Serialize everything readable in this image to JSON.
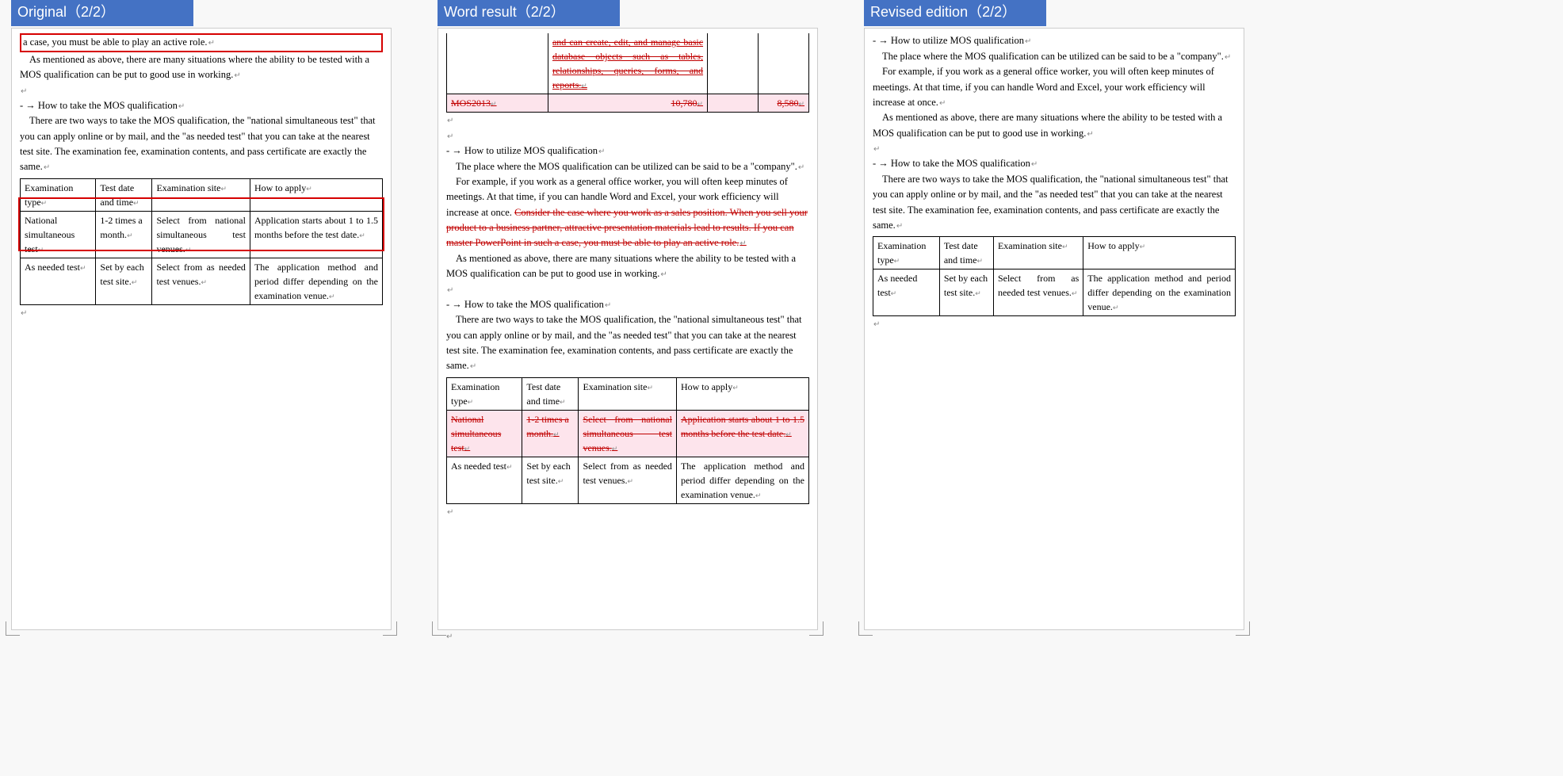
{
  "tabs": {
    "original": "Original（2/2）",
    "word_result": "Word result（2/2）",
    "revised": "Revised edition（2/2）"
  },
  "common": {
    "utilize_heading": "- → How to utilize MOS qualification",
    "take_heading": "- → How to take the MOS qualification",
    "utilize_p1": "The place where the MOS qualification can be utilized can be said to be a \"company\".",
    "utilize_p2": "For example, if you work as a general office worker, you will often keep minutes of meetings. At that time, if you can handle Word and Excel, your work efficiency will increase at once.",
    "sales_case": "Consider the case where you work as a sales position. When you sell your product to a business partner, attractive presentation materials lead to results. If you can master PowerPoint in such a case, you must be able to play an active role.",
    "active_role_tail": "a case, you must be able to play an active role.",
    "mentioned_above": "As mentioned as above, there are many situations where the ability to be tested with a MOS qualification can be put to good use in working.",
    "take_body": "There are two ways to take the MOS qualification, the \"national simultaneous test\" that you can apply online or by mail, and the \"as needed test\" that you can take at the nearest test site. The examination fee, examination contents, and pass certificate are exactly the same."
  },
  "table": {
    "headers": {
      "exam_type": "Examination type",
      "date_time": "Test date and time",
      "site": "Examination site",
      "apply": "How to apply"
    },
    "row_national": {
      "type": "National simultaneous test",
      "date": "1-2 times a month.",
      "site": "Select from national simultaneous test venues.",
      "apply": "Application starts about 1 to 1.5 months before the test date."
    },
    "row_needed": {
      "type": "As needed test",
      "date": "Set by each test site.",
      "site": "Select from as needed test venues.",
      "apply": "The application method and period differ depending on the examination venue."
    }
  },
  "word_result_top": {
    "cell_text": "and can create, edit, and manage basic database objects such as tables, relationships, queries, forms, and reports.",
    "mos2013": "MOS2013",
    "price1": "10,780",
    "price2": "8,580"
  }
}
